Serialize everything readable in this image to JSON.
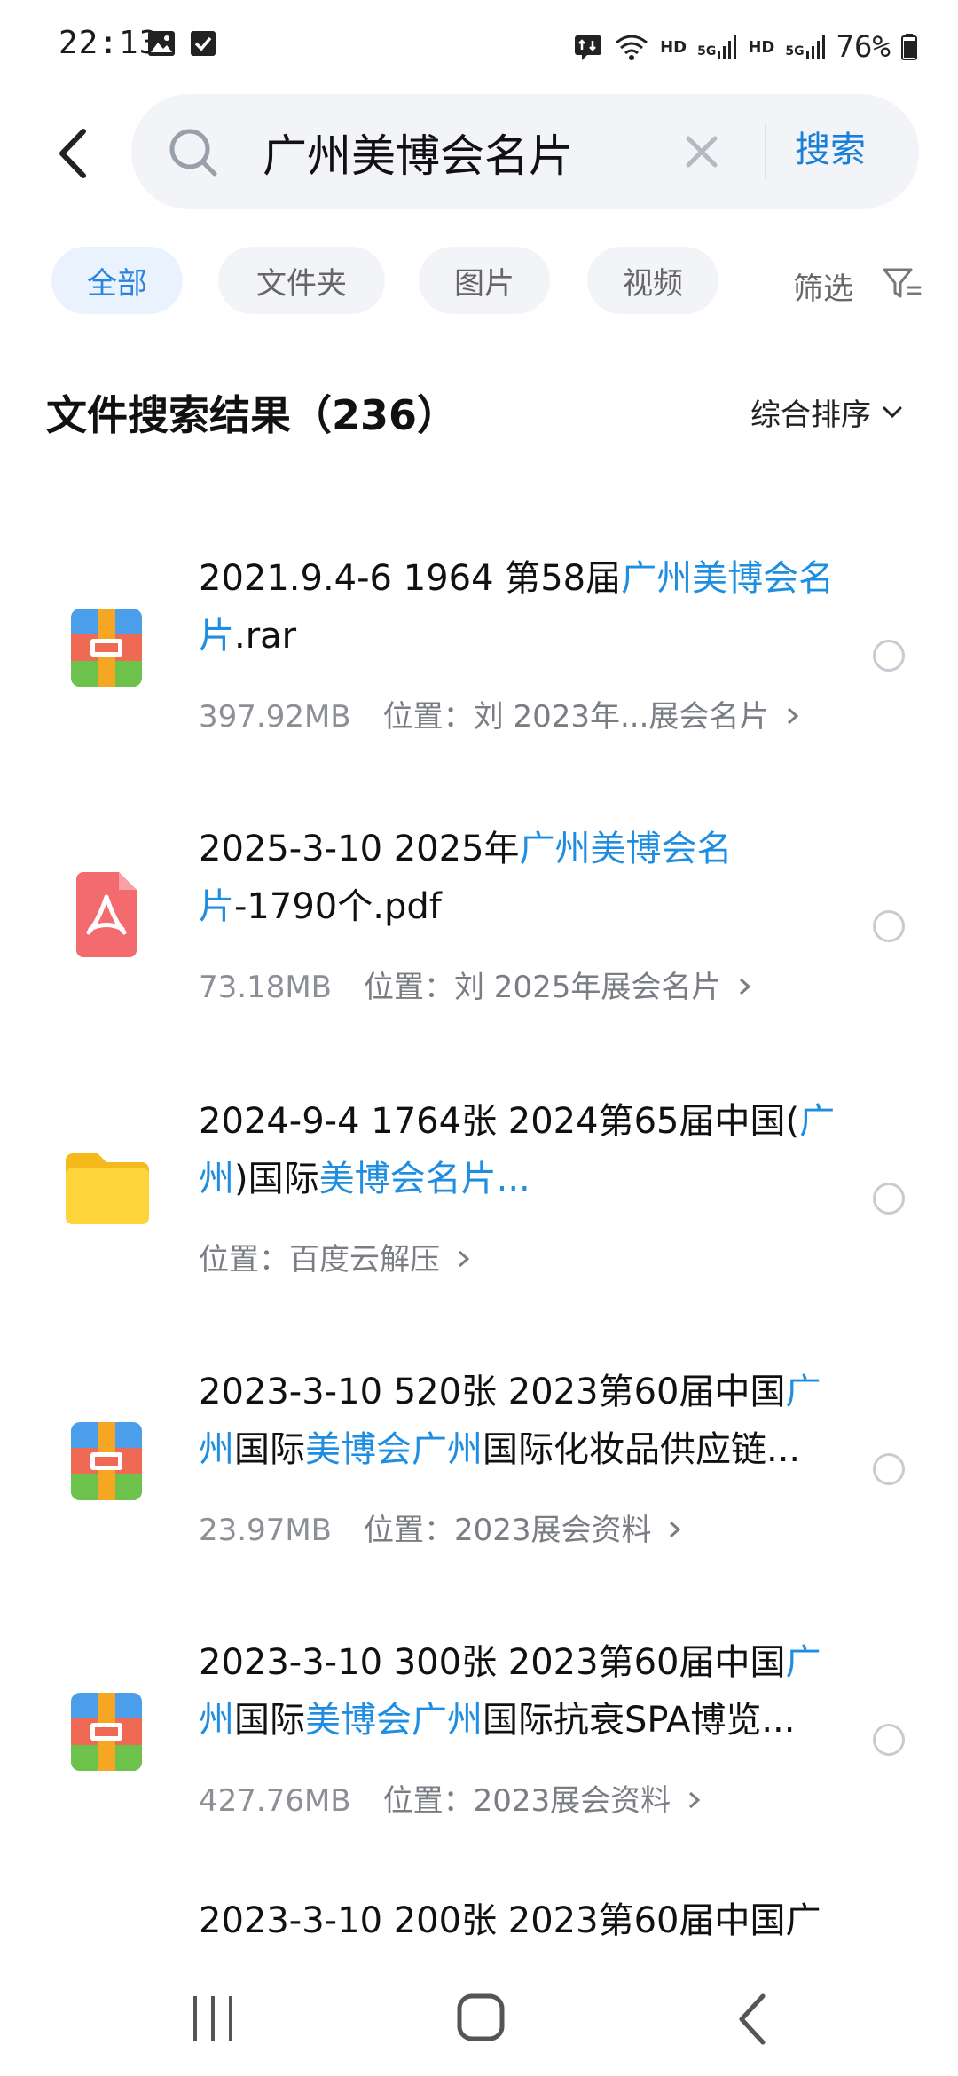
{
  "status_bar": {
    "time": "22:13",
    "hd1": "HD",
    "sig1": "5G",
    "hd2": "HD",
    "sig2": "5G",
    "battery": "76%"
  },
  "search": {
    "query": "广州美博会名片",
    "placeholder": "",
    "submit_label": "搜索"
  },
  "filters": {
    "chips": [
      {
        "label": "全部",
        "active": true
      },
      {
        "label": "文件夹",
        "active": false
      },
      {
        "label": "图片",
        "active": false
      },
      {
        "label": "视频",
        "active": false
      }
    ],
    "filter_label": "筛选"
  },
  "results": {
    "title": "文件搜索结果（236）",
    "sort_label": "综合排序",
    "items": [
      {
        "icon": "archive-icon",
        "title_parts": [
          {
            "t": "2021.9.4-6  1964 第58届",
            "h": false
          },
          {
            "t": "广州美博会名片",
            "h": true
          },
          {
            "t": ".rar",
            "h": false
          }
        ],
        "size": "397.92MB",
        "location": "位置：刘 2023年...展会名片"
      },
      {
        "icon": "pdf-icon",
        "title_parts": [
          {
            "t": "2025-3-10  2025年",
            "h": false
          },
          {
            "t": "广州美博会名片",
            "h": true
          },
          {
            "t": "-1790个.pdf",
            "h": false
          }
        ],
        "size": "73.18MB",
        "location": "位置：刘 2025年展会名片"
      },
      {
        "icon": "folder-icon",
        "title_parts": [
          {
            "t": "2024-9-4 1764张 2024第65届中国(",
            "h": false
          },
          {
            "t": "广州",
            "h": true
          },
          {
            "t": ")国际",
            "h": false
          },
          {
            "t": "美博会名片...",
            "h": true
          }
        ],
        "size": "",
        "location": "位置：百度云解压"
      },
      {
        "icon": "archive-icon",
        "title_parts": [
          {
            "t": "2023-3-10 520张 2023第60届中国",
            "h": false
          },
          {
            "t": "广州",
            "h": true
          },
          {
            "t": "国际",
            "h": false
          },
          {
            "t": "美博会广州",
            "h": true
          },
          {
            "t": "国际化妆品供应链...",
            "h": false
          }
        ],
        "size": "23.97MB",
        "location": "位置：2023展会资料"
      },
      {
        "icon": "archive-icon",
        "title_parts": [
          {
            "t": "2023-3-10 300张 2023第60届中国",
            "h": false
          },
          {
            "t": "广州",
            "h": true
          },
          {
            "t": "国际",
            "h": false
          },
          {
            "t": "美博会广州",
            "h": true
          },
          {
            "t": "国际抗衰SPA博览...",
            "h": false
          }
        ],
        "size": "427.76MB",
        "location": "位置：2023展会资料"
      }
    ],
    "partial_item_text": "2023-3-10 200张 2023第60届中国广"
  },
  "colors": {
    "accent": "#2a83e0",
    "highlight": "#1f8ee0",
    "meta": "#8c8f96"
  }
}
